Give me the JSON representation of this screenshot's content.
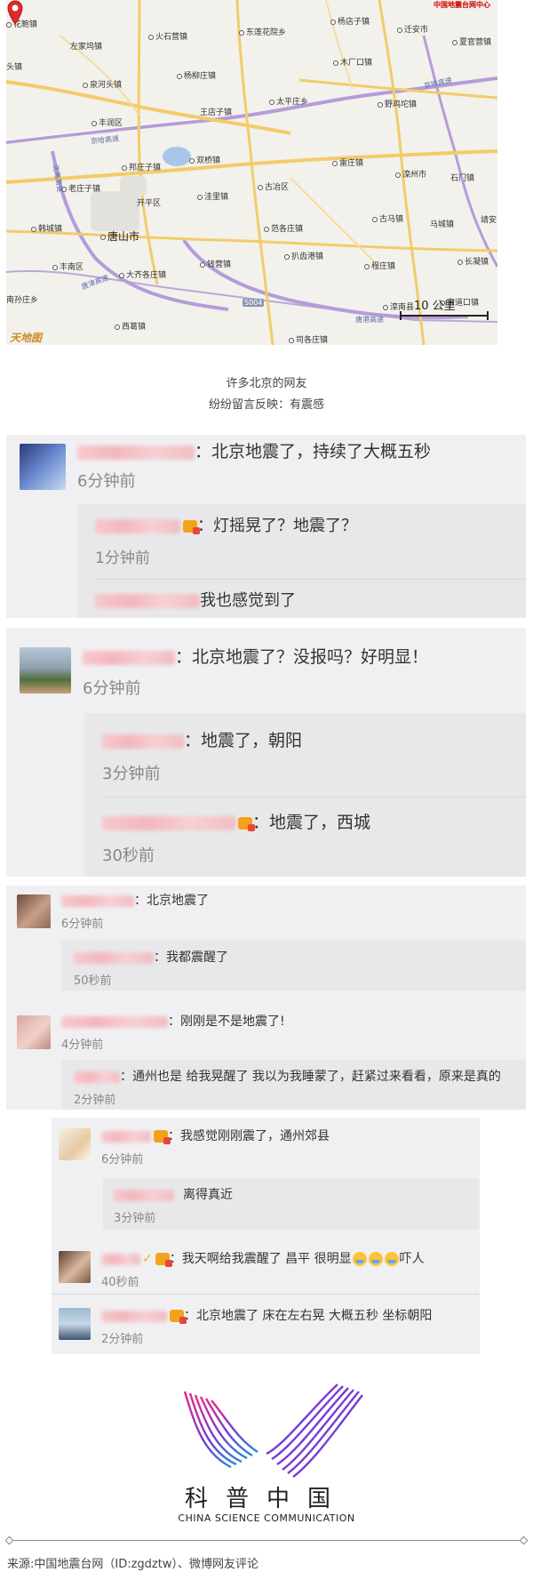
{
  "map": {
    "places": [
      {
        "name": "花鲍镇"
      },
      {
        "name": "火石营镇"
      },
      {
        "name": "东莲花院乡"
      },
      {
        "name": "杨店子镇"
      },
      {
        "name": "迁安市"
      },
      {
        "name": "左家坞镇"
      },
      {
        "name": "杨柳庄镇"
      },
      {
        "name": "木厂口镇"
      },
      {
        "name": "夏官营镇"
      },
      {
        "name": "泉河头镇"
      },
      {
        "name": "头镇"
      },
      {
        "name": "王店子镇"
      },
      {
        "name": "太平庄乡"
      },
      {
        "name": "野鸡坨镇"
      },
      {
        "name": "丰润区"
      },
      {
        "name": "邦庄子镇"
      },
      {
        "name": "双桥镇"
      },
      {
        "name": "雷庄镇"
      },
      {
        "name": "滦州市"
      },
      {
        "name": "石门镇"
      },
      {
        "name": "老庄子镇"
      },
      {
        "name": "古冶区"
      },
      {
        "name": "开平区"
      },
      {
        "name": "洼里镇"
      },
      {
        "name": "古马镇"
      },
      {
        "name": "马城镇"
      },
      {
        "name": "靖安"
      },
      {
        "name": "韩城镇"
      },
      {
        "name": "唐山市"
      },
      {
        "name": "范各庄镇"
      },
      {
        "name": "长凝镇"
      },
      {
        "name": "丰南区"
      },
      {
        "name": "大齐各庄镇"
      },
      {
        "name": "钱营镇"
      },
      {
        "name": "程庄镇"
      },
      {
        "name": "扒齿港镇"
      },
      {
        "name": "南孙庄乡"
      },
      {
        "name": "西葛镇"
      },
      {
        "name": "滦南县"
      },
      {
        "name": "宋道口镇"
      },
      {
        "name": "司各庄镇"
      }
    ],
    "roads": [
      "京哈高速",
      "京哈高速",
      "唐津高速",
      "唐港高速",
      "S004",
      "沈海高速"
    ],
    "scale": "10 公里",
    "brand": "中国地震台网中心",
    "tianditu": "天地图"
  },
  "caption": {
    "line1": "许多北京的网友",
    "line2": "纷纷留言反映：有震感"
  },
  "c1": {
    "main": {
      "text": "：北京地震了，持续了大概五秒",
      "time": "6分钟前"
    },
    "r1": {
      "text": "：灯摇晃了？地震了？",
      "time": "1分钟前"
    },
    "r2": {
      "text": "我也感觉到了"
    }
  },
  "c2": {
    "main": {
      "text": "：北京地震了？没报吗？好明显！",
      "time": "6分钟前"
    },
    "r1": {
      "text": "：地震了，朝阳",
      "time": "3分钟前"
    },
    "r2": {
      "text": "：地震了，西城",
      "time": "30秒前"
    }
  },
  "c3": {
    "a": {
      "text": "：北京地震了",
      "time": "6分钟前"
    },
    "a_r": {
      "text": "：我都震醒了",
      "time": "50秒前"
    },
    "b": {
      "text": "：刚刚是不是地震了!",
      "time": "4分钟前"
    },
    "b_r": {
      "text": "：通州也是 给我晃醒了 我以为我睡蒙了，赶紧过来看看，原来是真的",
      "time": "2分钟前"
    }
  },
  "c4": {
    "a": {
      "text": "：我感觉刚刚震了，通州郊县",
      "time": "6分钟前"
    },
    "a_r": {
      "text": "离得真近",
      "time": "3分钟前"
    },
    "b": {
      "text": "：我天啊给我震醒了 昌平 很明显",
      "tail": "吓人",
      "time": "40秒前"
    },
    "c": {
      "text": "：北京地震了  床在左右晃 大概五秒 坐标朝阳",
      "time": "2分钟前"
    }
  },
  "logo": {
    "cn": "科普中国",
    "en": "CHINA SCIENCE COMMUNICATION"
  },
  "source": "来源:中国地震台网（ID:zgdztw）、微博网友评论"
}
